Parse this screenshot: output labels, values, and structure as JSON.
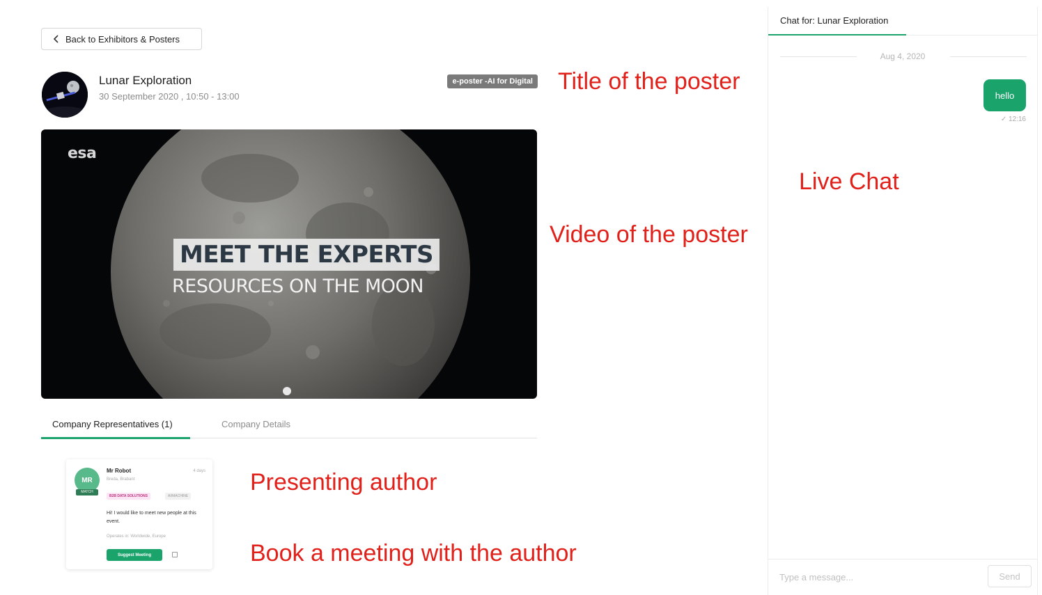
{
  "back_button": {
    "label": "Back to Exhibitors & Posters"
  },
  "poster": {
    "title": "Lunar Exploration",
    "datetime": "30 September 2020 , 10:50 - 13:00",
    "tag": "e-poster -AI for Digital"
  },
  "video": {
    "logo": "esa",
    "title": "MEET THE EXPERTS",
    "subtitle": "RESOURCES ON THE MOON"
  },
  "tabs": [
    {
      "label": "Company Representatives (1)",
      "active": true
    },
    {
      "label": "Company Details",
      "active": false
    }
  ],
  "representative": {
    "initials": "MR",
    "match_label": "MATCH",
    "name": "Mr Robot",
    "time_ago": "4 days",
    "location": "Breda, Brabant",
    "badge_company": "B2B DATA SOLUTIONS",
    "badge_role": "AI/MACHINE",
    "message": "Hi! I would like to meet new people at this event.",
    "operates_in": "Operates in: Worldwide, Europe",
    "meeting_button": "Suggest Meeting"
  },
  "annotations": {
    "title": "Title of the poster",
    "video": "Video of the poster",
    "chat": "Live Chat",
    "author": "Presenting author",
    "book": "Book a meeting with the author"
  },
  "chat": {
    "header": "Chat for: Lunar Exploration",
    "date": "Aug 4, 2020",
    "messages": [
      {
        "text": "hello",
        "time": "✓ 12:16"
      }
    ],
    "input_placeholder": "Type a message...",
    "send_label": "Send"
  },
  "colors": {
    "accent": "#1aa36b",
    "annotation": "#e1201a",
    "tag_background": "#7a7a7a"
  }
}
